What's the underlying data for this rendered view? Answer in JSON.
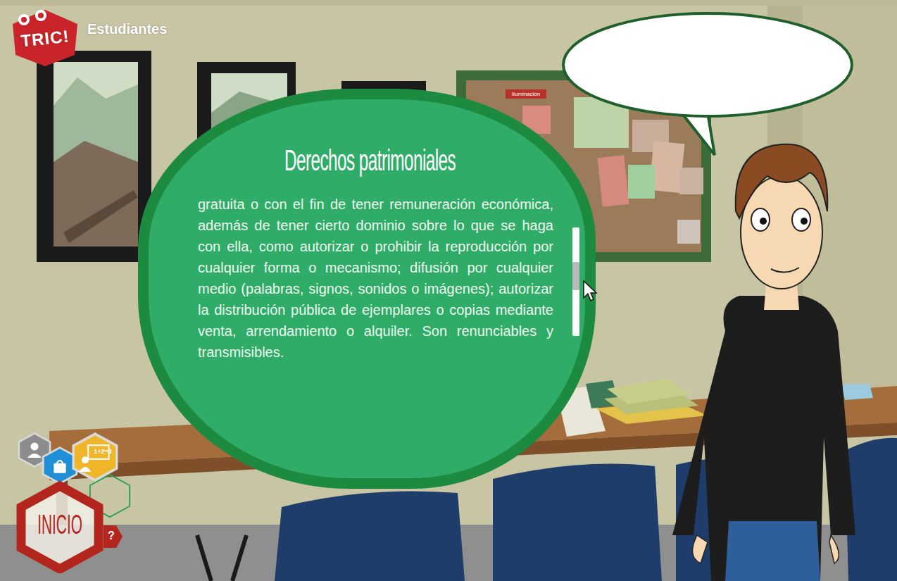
{
  "header": {
    "logo": "TRIC!",
    "section": "Estudiantes"
  },
  "board": {
    "label": "Iluminación"
  },
  "dialog": {
    "title": "Derechos patrimoniales",
    "body": "gratuita o con el fin de tener remuneración económica, además de  tener cierto dominio sobre lo que se haga con ella, como autorizar o prohibir la reproducción por cualquier forma o mecanismo; difusión por cualquier medio (palabras, signos, sonidos o imágenes); autorizar la distribución pública de ejemplares o copias mediante venta, arrendamiento o alquiler. Son renunciables y transmisibles.",
    "scrollbar": {
      "level": 0.43
    }
  },
  "nav": {
    "items": [
      {
        "kind": "profile",
        "label": "",
        "color": "#8c8c8c"
      },
      {
        "kind": "bag",
        "label": "",
        "color": "#1f8fd6"
      },
      {
        "kind": "teacher",
        "label": "1+2=3",
        "color": "#f1b52a"
      },
      {
        "kind": "outline",
        "label": "",
        "color": "#2e9e4f"
      }
    ],
    "home": "INICIO",
    "help": "?"
  }
}
